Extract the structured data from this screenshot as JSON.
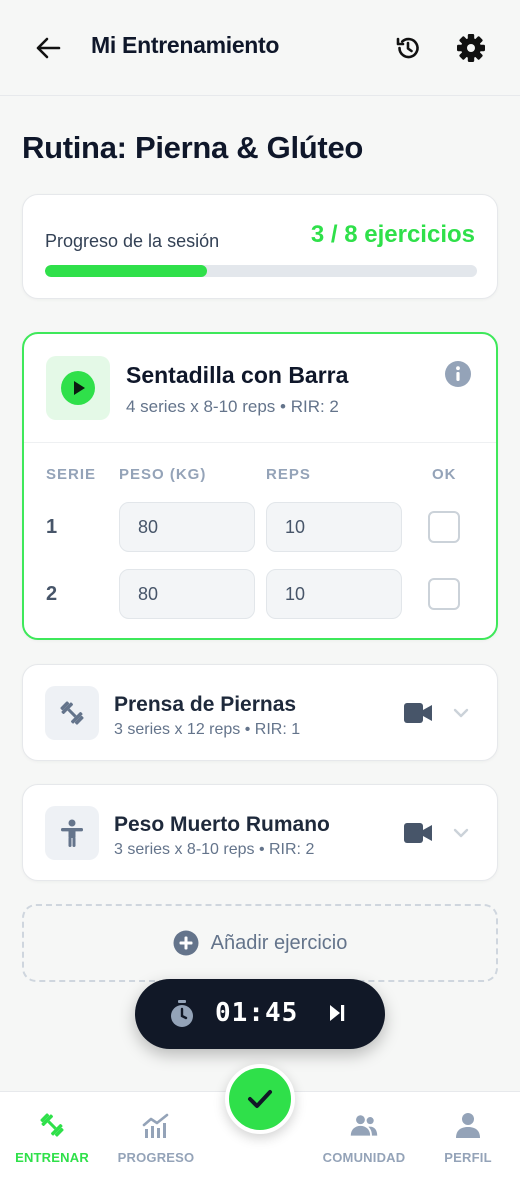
{
  "header": {
    "title": "Mi Entrenamiento"
  },
  "routine": {
    "title": "Rutina: Pierna & Glúteo"
  },
  "progress": {
    "label": "Progreso de la sesión",
    "count": "3 / 8 ejercicios",
    "completed": 3,
    "total": 8
  },
  "active_exercise": {
    "name": "Sentadilla con Barra",
    "meta": "4 series x 8-10 reps • RIR: 2",
    "columns": [
      "SERIE",
      "PESO (KG)",
      "REPS",
      "OK"
    ],
    "sets": [
      {
        "serie": "1",
        "peso": "80",
        "reps": "10",
        "ok": false
      },
      {
        "serie": "2",
        "peso": "80",
        "reps": "10",
        "ok": false
      }
    ]
  },
  "exercises": [
    {
      "name": "Prensa de Piernas",
      "meta": "3 series x 12 reps • RIR: 1",
      "icon": "dumbbell-icon"
    },
    {
      "name": "Peso Muerto Rumano",
      "meta": "3 series x 8-10 reps • RIR: 2",
      "icon": "person-icon"
    }
  ],
  "add_exercise": {
    "label": "Añadir ejercicio"
  },
  "timer": {
    "time": "01:45"
  },
  "nav": {
    "items": [
      {
        "label": "ENTRENAR",
        "active": true
      },
      {
        "label": "PROGRESO",
        "active": false
      },
      {
        "label": "COMUNIDAD",
        "active": false
      },
      {
        "label": "PERFIL",
        "active": false
      }
    ]
  },
  "colors": {
    "accent": "#2fe04a",
    "dark": "#111827",
    "muted": "#94a3b8"
  }
}
